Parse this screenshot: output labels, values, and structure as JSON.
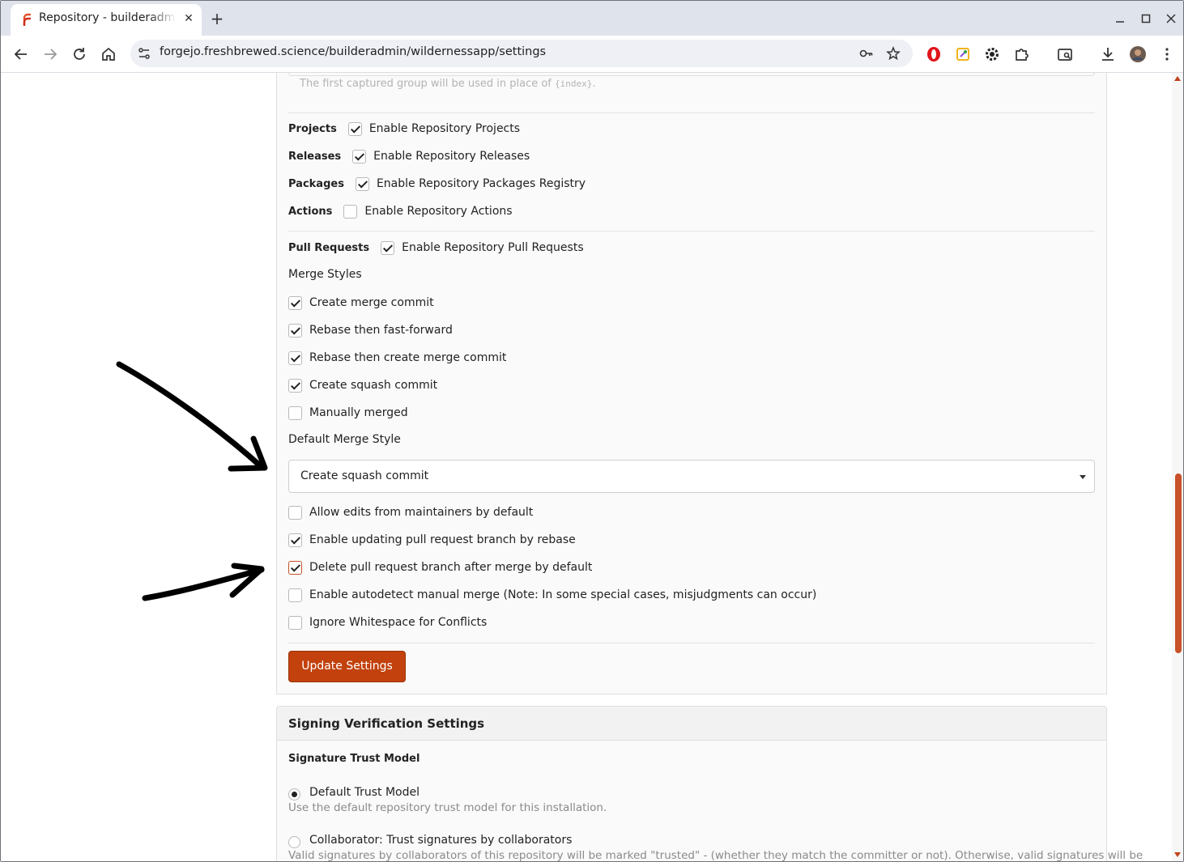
{
  "browser": {
    "tab_title": "Repository - builderadmin",
    "url": "forgejo.freshbrewed.science/builderadmin/wildernessapp/settings",
    "new_tab": "+",
    "close_tab": "✕",
    "window_controls": {
      "minimize": "—",
      "maximize": "☐",
      "close": "✕"
    },
    "icons": [
      "back-icon",
      "forward-icon",
      "reload-icon",
      "home-icon",
      "site-info-icon",
      "password-key-icon",
      "bookmark-star-icon",
      "opera-extension-icon",
      "color-picker-extension-icon",
      "gear-extension-icon",
      "puzzle-extensions-icon",
      "tab-search-icon",
      "download-icon",
      "profile-avatar-icon",
      "menu-icon"
    ]
  },
  "settings": {
    "hint_text": "The first captured group will be used in place of ",
    "hint_code": "{index}",
    "hint_end": ".",
    "units": [
      {
        "label": "Projects",
        "option": "Enable Repository Projects",
        "checked": true
      },
      {
        "label": "Releases",
        "option": "Enable Repository Releases",
        "checked": true
      },
      {
        "label": "Packages",
        "option": "Enable Repository Packages Registry",
        "checked": true
      },
      {
        "label": "Actions",
        "option": "Enable Repository Actions",
        "checked": false
      }
    ],
    "pull_requests": {
      "label": "Pull Requests",
      "option": "Enable Repository Pull Requests",
      "checked": true
    },
    "merge_styles_heading": "Merge Styles",
    "merge_styles": [
      {
        "label": "Create merge commit",
        "checked": true
      },
      {
        "label": "Rebase then fast-forward",
        "checked": true
      },
      {
        "label": "Rebase then create merge commit",
        "checked": true
      },
      {
        "label": "Create squash commit",
        "checked": true
      },
      {
        "label": "Manually merged",
        "checked": false
      }
    ],
    "default_merge_style_heading": "Default Merge Style",
    "default_merge_style_value": "Create squash commit",
    "pr_options": [
      {
        "label": "Allow edits from maintainers by default",
        "checked": false
      },
      {
        "label": "Enable updating pull request branch by rebase",
        "checked": true
      },
      {
        "label": "Delete pull request branch after merge by default",
        "checked": true
      },
      {
        "label": "Enable autodetect manual merge (Note: In some special cases, misjudgments can occur)",
        "checked": false
      },
      {
        "label": "Ignore Whitespace for Conflicts",
        "checked": false
      }
    ],
    "update_button": "Update Settings"
  },
  "signing": {
    "title": "Signing Verification Settings",
    "trust_model_heading": "Signature Trust Model",
    "options": [
      {
        "label": "Default Trust Model",
        "desc": "Use the default repository trust model for this installation.",
        "selected": true
      },
      {
        "label": "Collaborator: Trust signatures by collaborators",
        "desc": "Valid signatures by collaborators of this repository will be marked \"trusted\" - (whether they match the committer or not). Otherwise, valid signatures will be",
        "selected": false
      }
    ]
  },
  "colors": {
    "accent": "#c2410c",
    "tab_strip": "#dfe3ec"
  }
}
